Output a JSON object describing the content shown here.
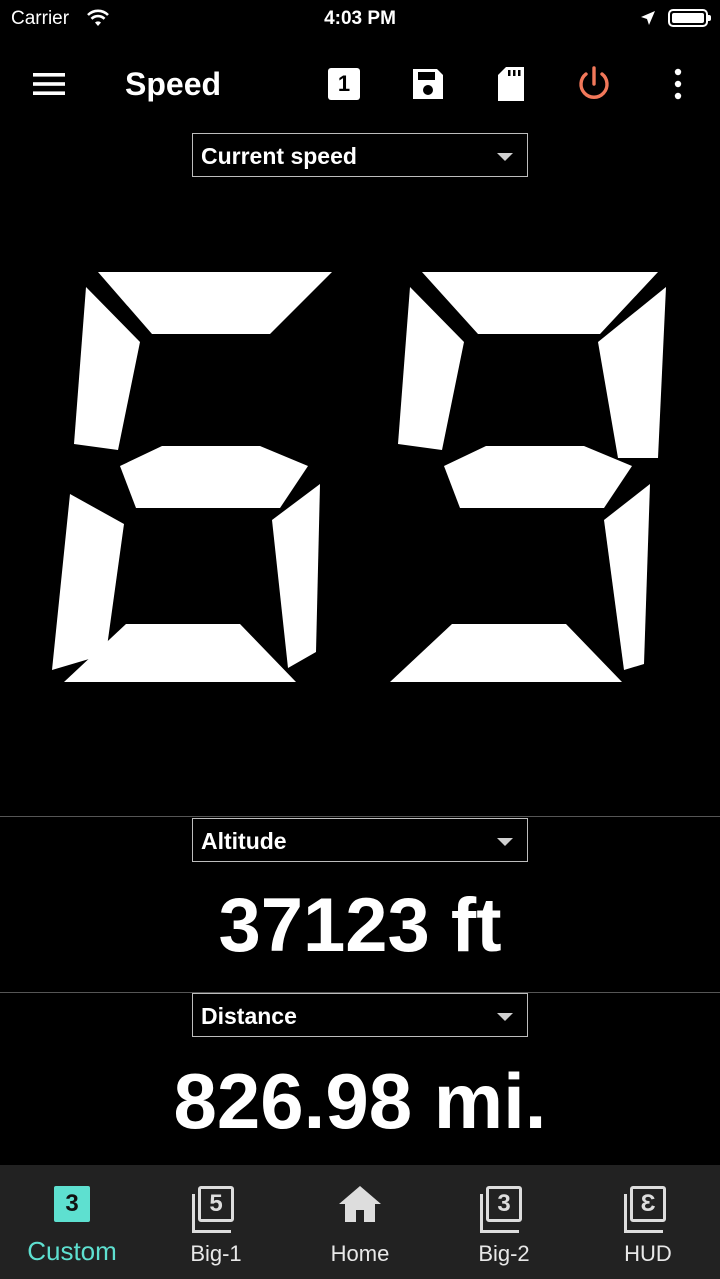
{
  "status_bar": {
    "carrier": "Carrier",
    "time": "4:03 PM"
  },
  "toolbar": {
    "title": "Speed",
    "page_badge": "1",
    "power_color": "#f2785a"
  },
  "primary": {
    "selector_label": "Current speed",
    "value": "69"
  },
  "secondary": [
    {
      "selector_label": "Altitude",
      "value": "37123 ft"
    },
    {
      "selector_label": "Distance",
      "value": "826.98 mi."
    }
  ],
  "tabs": [
    {
      "label": "Custom",
      "badge": "3",
      "active": true
    },
    {
      "label": "Big-1",
      "badge": "5",
      "active": false
    },
    {
      "label": "Home",
      "icon": "home-icon",
      "active": false
    },
    {
      "label": "Big-2",
      "badge": "3",
      "active": false
    },
    {
      "label": "HUD",
      "badge": "Ɛ",
      "active": false
    }
  ],
  "colors": {
    "accent": "#5ee0d0",
    "background": "#000000",
    "tab_bar": "#222222"
  }
}
